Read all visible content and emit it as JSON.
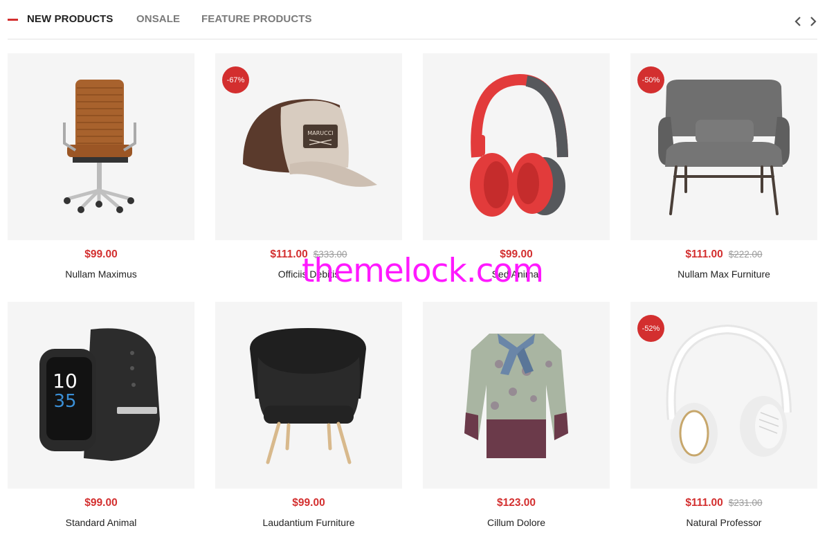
{
  "tabs": [
    {
      "label": "NEW PRODUCTS",
      "active": true
    },
    {
      "label": "ONSALE",
      "active": false
    },
    {
      "label": "FEATURE PRODUCTS",
      "active": false
    }
  ],
  "navigation": {
    "prev_icon": "chevron-left-icon",
    "next_icon": "chevron-right-icon"
  },
  "colors": {
    "accent": "#d32f2f",
    "card_background": "#f5f5f5",
    "watermark": "#ff19ff"
  },
  "products": [
    {
      "name": "Nullam Maximus",
      "price": "$99.00",
      "old_price": "",
      "badge": "",
      "image": "office-chair"
    },
    {
      "name": "Officiis Debitis",
      "price": "$111.00",
      "old_price": "$333.00",
      "badge": "-67%",
      "image": "baseball-cap"
    },
    {
      "name": "Sed Animal",
      "price": "$99.00",
      "old_price": "",
      "badge": "",
      "image": "red-headphones"
    },
    {
      "name": "Nullam Max Furniture",
      "price": "$111.00",
      "old_price": "$222.00",
      "badge": "-50%",
      "image": "lounge-chair"
    },
    {
      "name": "Standard Animal",
      "price": "$99.00",
      "old_price": "",
      "badge": "",
      "image": "smartwatch"
    },
    {
      "name": "Laudantium Furniture",
      "price": "$99.00",
      "old_price": "",
      "badge": "",
      "image": "armchair"
    },
    {
      "name": "Cillum Dolore",
      "price": "$123.00",
      "old_price": "",
      "badge": "",
      "image": "floral-blouse"
    },
    {
      "name": "Natural Professor",
      "price": "$111.00",
      "old_price": "$231.00",
      "badge": "-52%",
      "image": "white-headphones"
    }
  ],
  "watch_face": {
    "hour": "10",
    "minute": "35"
  },
  "cap_patch_text": "MARUCCI",
  "watermark": "themelock.com"
}
